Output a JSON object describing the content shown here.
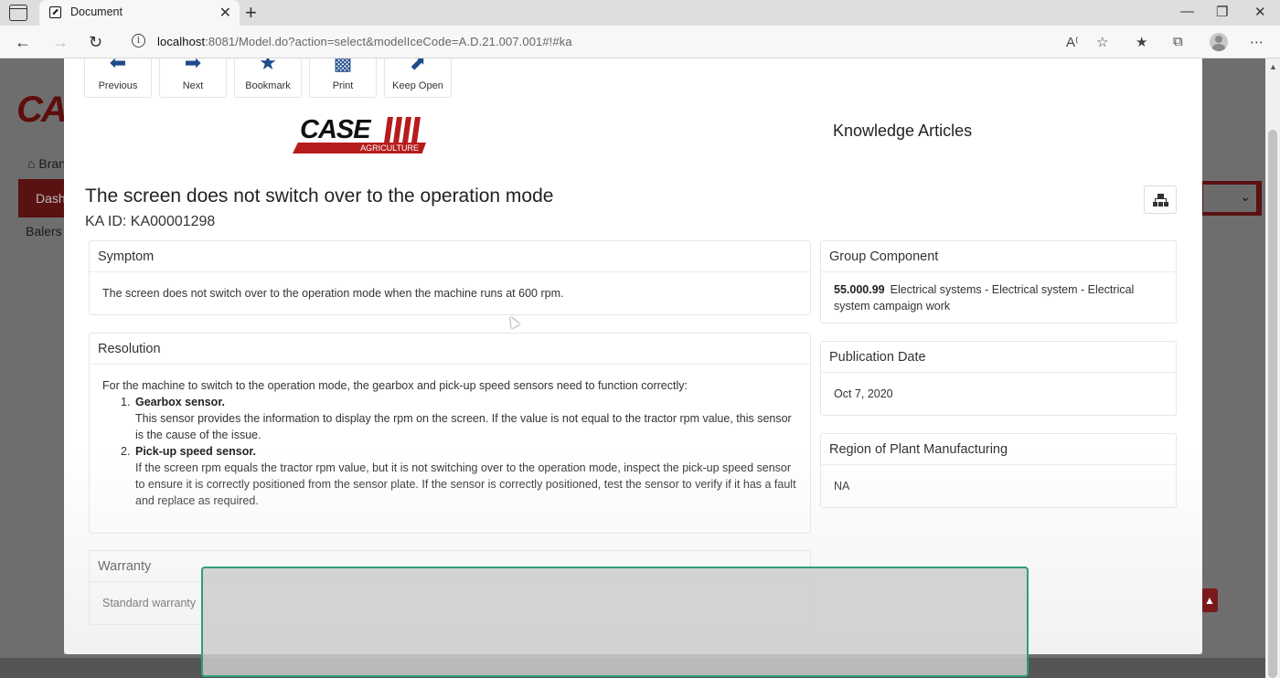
{
  "browser": {
    "tab_title": "Document",
    "tab_close": "✕",
    "new_tab": "+",
    "url_host": "localhost",
    "url_rest": ":8081/Model.do?action=select&modelIceCode=A.D.21.007.001#!#ka",
    "window_controls": {
      "minimize": "—",
      "restore": "❐",
      "close": "✕"
    },
    "icons": {
      "back": "arrow-left-icon",
      "forward": "arrow-right-icon",
      "refresh": "refresh-icon",
      "info": "info-icon",
      "read_aloud": "read-aloud-icon",
      "favorite": "add-favorite-icon",
      "favorites": "favorites-icon",
      "collections": "collections-icon",
      "profile": "profile-icon",
      "menu": "more-icon"
    }
  },
  "background_page": {
    "logo": "CA",
    "home_link": "Bran",
    "dashboard_tab": "Dash",
    "balers_label": "Balers"
  },
  "toolbar": {
    "previous": "Previous",
    "next": "Next",
    "bookmark": "Bookmark",
    "print": "Print",
    "keep_open": "Keep Open"
  },
  "brand": {
    "logo_word": "CASE",
    "logo_sub": "AGRICULTURE",
    "brand_color": "#b71c1c"
  },
  "header_title": "Knowledge Articles",
  "article": {
    "title": "The screen does not switch over to the operation mode",
    "ka_id": "KA ID: KA00001298",
    "symptom": {
      "heading": "Symptom",
      "text": "The screen does not switch over to the operation mode when the machine runs at 600 rpm."
    },
    "resolution": {
      "heading": "Resolution",
      "intro": "For the machine to switch to the operation mode, the gearbox and pick-up speed sensors need to function correctly:",
      "items": [
        {
          "num": "1.",
          "title": "Gearbox sensor.",
          "text": "This sensor provides the information to display the rpm on the screen. If the value is not equal to the tractor rpm value, this sensor is the cause of the issue."
        },
        {
          "num": "2.",
          "title": "Pick-up speed sensor.",
          "text": "If the screen rpm equals the tractor rpm value, but it is not switching over to the operation mode, inspect the pick-up speed sensor to ensure it is correctly positioned from the sensor plate. If the sensor is correctly positioned, test the sensor to verify if it has a fault and replace as required."
        }
      ]
    },
    "warranty": {
      "heading": "Warranty",
      "text": "Standard warranty"
    },
    "group_component": {
      "heading": "Group Component",
      "code": "55.000.99",
      "text": "Electrical systems  - Electrical system  - Electrical system campaign work"
    },
    "publication_date": {
      "heading": "Publication Date",
      "text": "Oct 7, 2020"
    },
    "region": {
      "heading": "Region of Plant Manufacturing",
      "text": "NA"
    }
  }
}
